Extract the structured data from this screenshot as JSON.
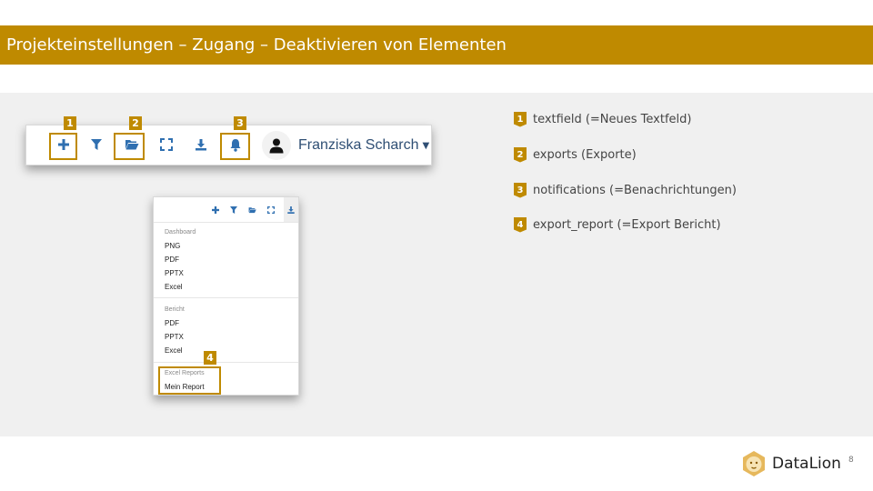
{
  "slide": {
    "title": "Projekteinstellungen – Zugang – Deaktivieren von Elementen",
    "page_number": "8",
    "accent_color": "#bf8a00"
  },
  "toolbar": {
    "icons": [
      "plus-icon",
      "filter-icon",
      "folder-open-icon",
      "expand-icon",
      "download-icon",
      "bell-icon"
    ],
    "highlights": [
      "1",
      "2",
      "3"
    ],
    "user_name": "Franziska Scharch"
  },
  "dropdown": {
    "icons": [
      "plus-icon",
      "filter-icon",
      "folder-open-icon",
      "expand-icon",
      "download-icon"
    ],
    "sections": [
      {
        "header": "Dashboard",
        "items": [
          "PNG",
          "PDF",
          "PPTX",
          "Excel"
        ]
      },
      {
        "header": "Bericht",
        "items": [
          "PDF",
          "PPTX",
          "Excel"
        ]
      },
      {
        "header": "Excel Reports",
        "items": [
          "Mein Report"
        ]
      }
    ],
    "highlight": "4"
  },
  "legend": [
    {
      "num": "1",
      "text": "textfield (=Neues Textfeld)"
    },
    {
      "num": "2",
      "text": "exports (Exporte)"
    },
    {
      "num": "3",
      "text": "notifications (=Benachrichtungen)"
    },
    {
      "num": "4",
      "text": "export_report (=Export Bericht)"
    }
  ],
  "footer": {
    "logo_text": "DataLion"
  }
}
